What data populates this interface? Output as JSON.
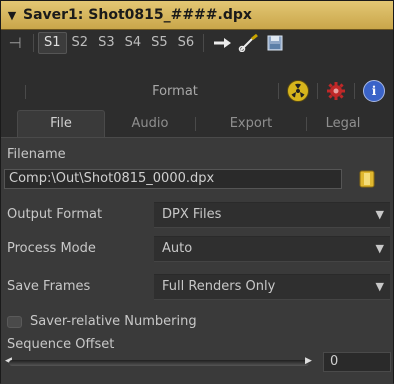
{
  "title": "Saver1: Shot0815_####.dpx",
  "toolbar": {
    "pin_icon": "pin-icon",
    "sub_tabs": [
      "S1",
      "S2",
      "S3",
      "S4",
      "S5",
      "S6"
    ],
    "active_sub_tab": "S1",
    "tool_icons": [
      "view-arrow-icon",
      "connect-wrench-icon",
      "save-disk-icon"
    ]
  },
  "row2": {
    "format_label": "Format",
    "icons": [
      "radiation-icon",
      "gear-icon",
      "info-icon"
    ]
  },
  "tabs": {
    "file": "File",
    "audio": "Audio",
    "export": "Export",
    "legal": "Legal"
  },
  "fields": {
    "filename_label": "Filename",
    "filename_value": "Comp:\\Out\\Shot0815_0000.dpx",
    "output_format_label": "Output Format",
    "output_format_value": "DPX Files",
    "process_mode_label": "Process Mode",
    "process_mode_value": "Auto",
    "save_frames_label": "Save Frames",
    "save_frames_value": "Full Renders Only",
    "saver_relative_label": "Saver-relative Numbering",
    "sequence_offset_label": "Sequence Offset",
    "sequence_offset_value": "0"
  },
  "colors": {
    "title_gold": "#d6b55c",
    "radiation_yellow": "#e4c020",
    "gear_red": "#c03030",
    "info_blue": "#3a63c8"
  }
}
